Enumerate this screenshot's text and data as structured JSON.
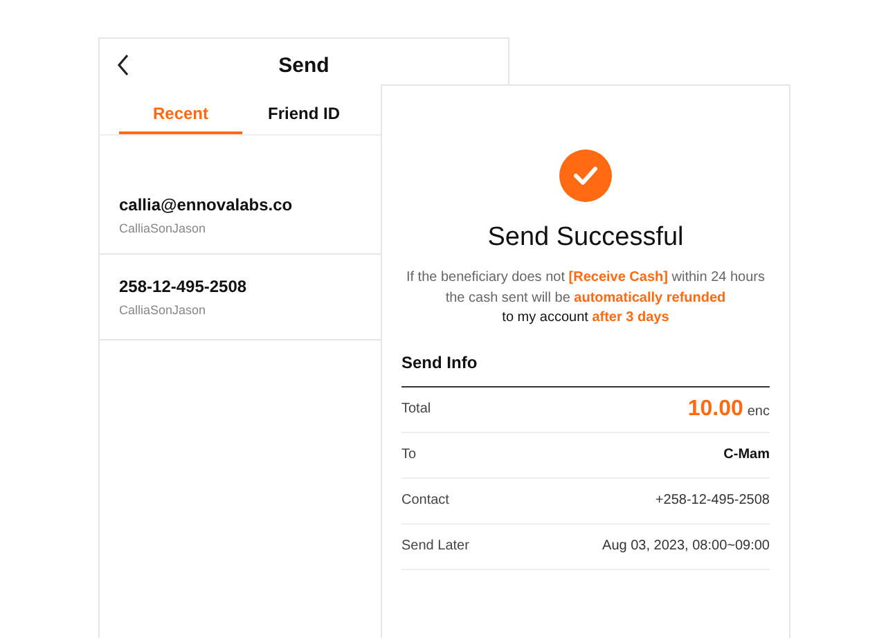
{
  "send_screen": {
    "title": "Send",
    "tabs": [
      {
        "label": "Recent",
        "selected": true
      },
      {
        "label": "Friend ID",
        "selected": false
      }
    ],
    "recents": [
      {
        "primary": "callia@ennovalabs.co",
        "secondary": "CalliaSonJason"
      },
      {
        "primary": "258-12-495-2508",
        "secondary": "CalliaSonJason"
      }
    ]
  },
  "result_card": {
    "title": "Send Successful",
    "message_lines": [
      "If the beneficiary does not **[Receive Cash]** within 24 hours",
      "the cash sent will be **automatically refunded**",
      "to my account **after 3 days**"
    ],
    "section_title": "Send Info",
    "rows": [
      {
        "kind": "amount",
        "label": "Total",
        "value": "10.00",
        "unit": "enc"
      },
      {
        "kind": "bold",
        "label": "To",
        "value": "C-Mam"
      },
      {
        "kind": "plain",
        "label": "Contact",
        "value": "+258-12-495-2508"
      },
      {
        "kind": "plain",
        "label": "Send Later",
        "value": "Aug 03, 2023, 08:00~09:00"
      }
    ]
  }
}
